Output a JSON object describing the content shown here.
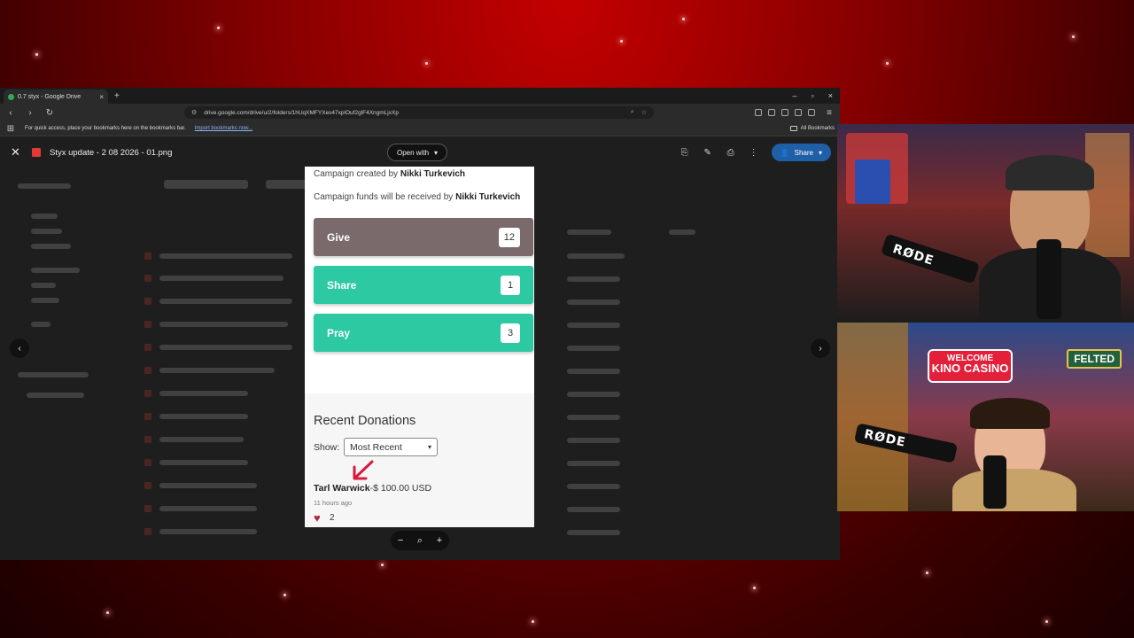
{
  "browser": {
    "tab_title": "0.7 styx - Google Drive",
    "tab_close": "×",
    "new_tab": "+",
    "window_controls": [
      "–",
      "▫",
      "×"
    ],
    "url": "drive.google.com/drive/u/2/folders/1hUqXMFYXes47xplOuf2glF4XngmLjxXp",
    "bookmarks_hint": "For quick access, place your bookmarks here on the bookmarks bar.",
    "import_bookmarks": "Import bookmarks now...",
    "all_bookmarks": "All Bookmarks"
  },
  "viewer": {
    "close_icon": "✕",
    "file_title": "Styx update - 2 08 2026 - 01.png",
    "open_with": "Open with",
    "share": "Share",
    "prev": "‹",
    "next": "›"
  },
  "preview": {
    "created_prefix": "Campaign created by ",
    "created_by": "Nikki Turkevich",
    "received_prefix": "Campaign funds will be received by ",
    "received_by": "Nikki Turkevich",
    "actions": [
      {
        "label": "Give",
        "count": "12",
        "color": "#7a6a6b"
      },
      {
        "label": "Share",
        "count": "1",
        "color": "#2dc9a3"
      },
      {
        "label": "Pray",
        "count": "3",
        "color": "#2dc9a3"
      }
    ],
    "recent_title": "Recent Donations",
    "show_label": "Show:",
    "show_value": "Most Recent",
    "donor_name": "Tarl Warwick",
    "donor_amount": "-$ 100.00 USD",
    "donor_time": "11 hours ago",
    "likes": "2"
  },
  "zoom": {
    "minus": "−",
    "search": "⌕",
    "plus": "+"
  },
  "cams": {
    "top_mic_brand": "RØDE",
    "bottom_mic_brand": "RØDE",
    "sign_line1": "WELCOME",
    "sign_line2": "KINO CASINO",
    "felted": "FELTED"
  }
}
